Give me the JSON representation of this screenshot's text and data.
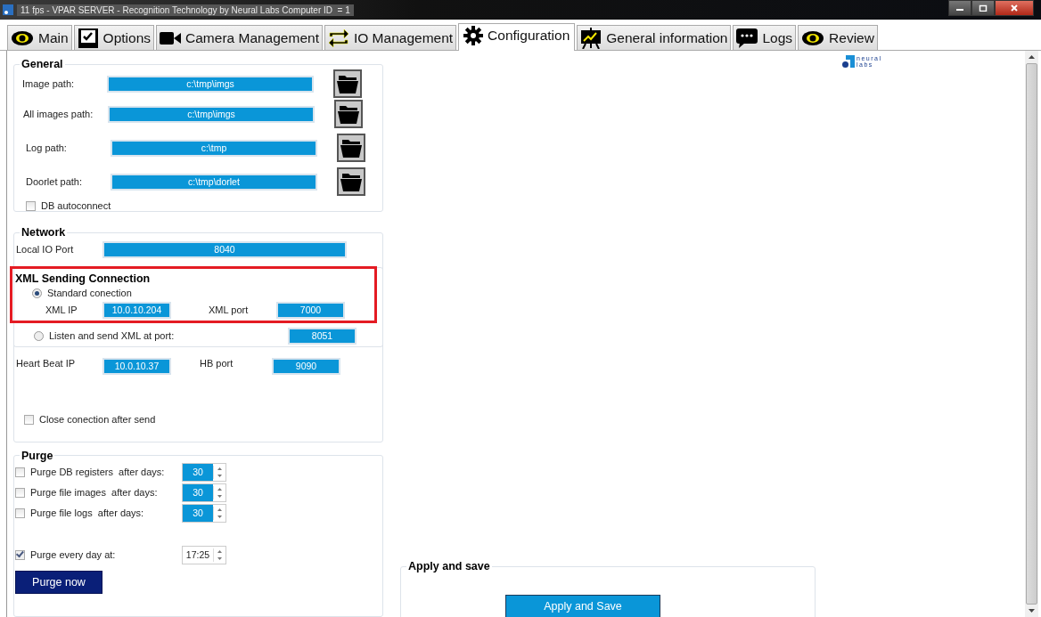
{
  "window": {
    "title": "11 fps - VPAR SERVER - Recognition Technology by Neural Labs Computer ID  = 1"
  },
  "tabs": [
    {
      "label": "Main",
      "selected": false
    },
    {
      "label": "Options",
      "selected": false
    },
    {
      "label": "Camera Management",
      "selected": false
    },
    {
      "label": "IO Management",
      "selected": false
    },
    {
      "label": "Configuration",
      "selected": true
    },
    {
      "label": "General information",
      "selected": false
    },
    {
      "label": "Logs",
      "selected": false
    },
    {
      "label": "Review",
      "selected": false
    }
  ],
  "logo": {
    "line_1": "neural",
    "line_2": "labs"
  },
  "general": {
    "title": "General",
    "paths": [
      {
        "label": "Image path:",
        "value": "c:\\tmp\\imgs"
      },
      {
        "label": "All images path:",
        "value": "c:\\tmp\\imgs"
      },
      {
        "label": "Log path:",
        "value": "c:\\tmp"
      },
      {
        "label": "Doorlet path:",
        "value": "c:\\tmp\\dorlet"
      }
    ],
    "db_autoconnect": {
      "label": "DB autoconnect",
      "checked": false
    }
  },
  "network": {
    "title": "Network",
    "local_io_port": {
      "label": "Local IO Port",
      "value": "8040"
    }
  },
  "xml": {
    "title": "XML Sending Connection",
    "highlighted": true,
    "options": [
      {
        "label": "Standard conection",
        "selected": true
      },
      {
        "label": "Listen and send XML at port:",
        "selected": false
      }
    ],
    "xml_ip": {
      "label": "XML IP",
      "value": "10.0.10.204"
    },
    "xml_port": {
      "label": "XML port",
      "value": "7000"
    },
    "listen_port": "8051"
  },
  "heartbeat": {
    "ip": {
      "label": "Heart Beat IP",
      "value": "10.0.10.37"
    },
    "port": {
      "label": "HB port",
      "value": "9090"
    },
    "close_after_send": {
      "label": "Close conection after send",
      "checked": false
    }
  },
  "purge": {
    "title": "Purge",
    "rules": [
      {
        "label": "Purge DB registers  after days:",
        "checked": false,
        "value": "30"
      },
      {
        "label": "Purge file images  after days:",
        "checked": false,
        "value": "30"
      },
      {
        "label": "Purge file logs  after days:",
        "checked": false,
        "value": "30"
      }
    ],
    "daily": {
      "label": "Purge every day at:",
      "checked": true,
      "value": "17:25"
    },
    "button": "Purge now"
  },
  "apply": {
    "title": "Apply and save",
    "button": "Apply and Save"
  }
}
